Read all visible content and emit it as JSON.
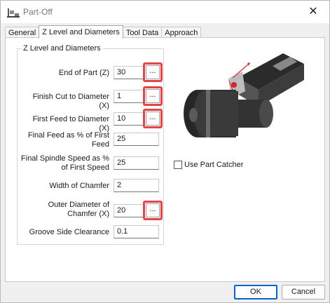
{
  "window": {
    "title": "Part-Off",
    "close_glyph": "✕"
  },
  "tabs": [
    {
      "label": "General",
      "active": false
    },
    {
      "label": "Z Level and Diameters",
      "active": true
    },
    {
      "label": "Tool Data",
      "active": false
    },
    {
      "label": "Approach",
      "active": false
    }
  ],
  "group": {
    "title": "Z Level and Diameters",
    "fields": [
      {
        "label": "End of Part (Z)",
        "value": "30",
        "has_browse": true,
        "highlighted": true
      },
      {
        "label": "Finish Cut to Diameter (X)",
        "value": "1",
        "has_browse": true,
        "highlighted": true
      },
      {
        "label": "First Feed to Diameter (X)",
        "value": "10",
        "has_browse": true,
        "highlighted": true
      },
      {
        "label": "Final Feed as % of First Feed",
        "value": "25",
        "has_browse": false
      },
      {
        "label": "Final Spindle Speed as % of First Speed",
        "value": "25",
        "has_browse": false
      },
      {
        "label": "Width of Chamfer",
        "value": "2",
        "has_browse": false
      },
      {
        "label": "Outer Diameter of Chamfer (X)",
        "value": "20",
        "has_browse": true,
        "highlighted": true
      },
      {
        "label": "Groove Side Clearance",
        "value": "0.1",
        "has_browse": false
      }
    ],
    "browse_label": "..."
  },
  "part_catcher": {
    "label": "Use Part Catcher",
    "checked": false
  },
  "buttons": {
    "ok": "OK",
    "cancel": "Cancel"
  },
  "colors": {
    "highlight": "#e0474c",
    "accent": "#0067c0"
  }
}
